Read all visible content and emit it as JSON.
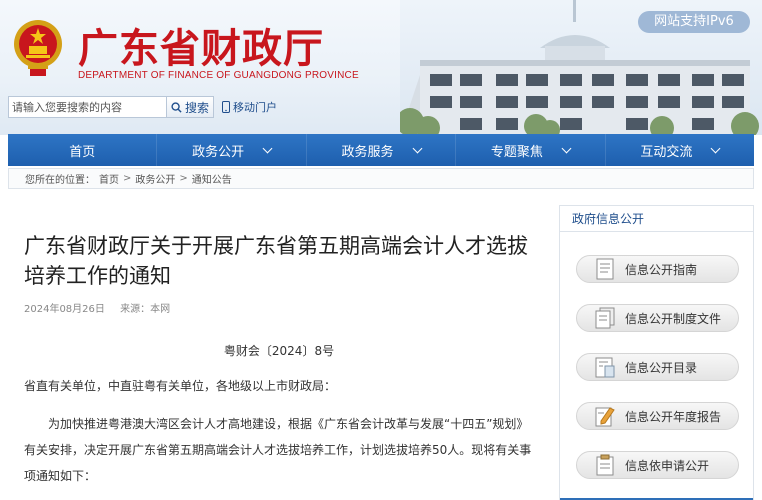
{
  "header": {
    "title": "广东省财政厅",
    "subtitle": "DEPARTMENT OF FINANCE OF GUANGDONG PROVINCE",
    "ipv6_badge": "网站支持IPv6"
  },
  "search": {
    "placeholder": "请输入您要搜索的内容",
    "button_label": "搜索",
    "mobile_link": "移动门户"
  },
  "nav": {
    "items": [
      {
        "label": "首页",
        "dropdown": false
      },
      {
        "label": "政务公开",
        "dropdown": true
      },
      {
        "label": "政务服务",
        "dropdown": true
      },
      {
        "label": "专题聚焦",
        "dropdown": true
      },
      {
        "label": "互动交流",
        "dropdown": true
      }
    ]
  },
  "breadcrumb": {
    "prefix": "您所在的位置：",
    "items": [
      "首页",
      "政务公开",
      "通知公告"
    ],
    "separator": ">"
  },
  "article": {
    "title": "广东省财政厅关于开展广东省第五期高端会计人才选拔培养工作的通知",
    "date": "2024年08月26日",
    "source": "来源：本网",
    "doc_number": "粤财会〔2024〕8号",
    "salutation": "省直有关单位，中直驻粤有关单位，各地级以上市财政局：",
    "body_p1": "为加快推进粤港澳大湾区会计人才高地建设，根据《广东省会计改革与发展“十四五”规划》有关安排，决定开展广东省第五期高端会计人才选拔培养工作，计划选拔培养50人。现将有关事项通知如下："
  },
  "sidebar": {
    "heading": "政府信息公开",
    "items": [
      {
        "label": "信息公开指南",
        "icon": "document-icon"
      },
      {
        "label": "信息公开制度文件",
        "icon": "file-stack-icon"
      },
      {
        "label": "信息公开目录",
        "icon": "folder-list-icon"
      },
      {
        "label": "信息公开年度报告",
        "icon": "report-pen-icon"
      },
      {
        "label": "信息依申请公开",
        "icon": "clipboard-icon"
      }
    ]
  },
  "colors": {
    "brand_red": "#c8161d",
    "nav_blue": "#1e5fae",
    "link_blue": "#1f4e8c"
  }
}
